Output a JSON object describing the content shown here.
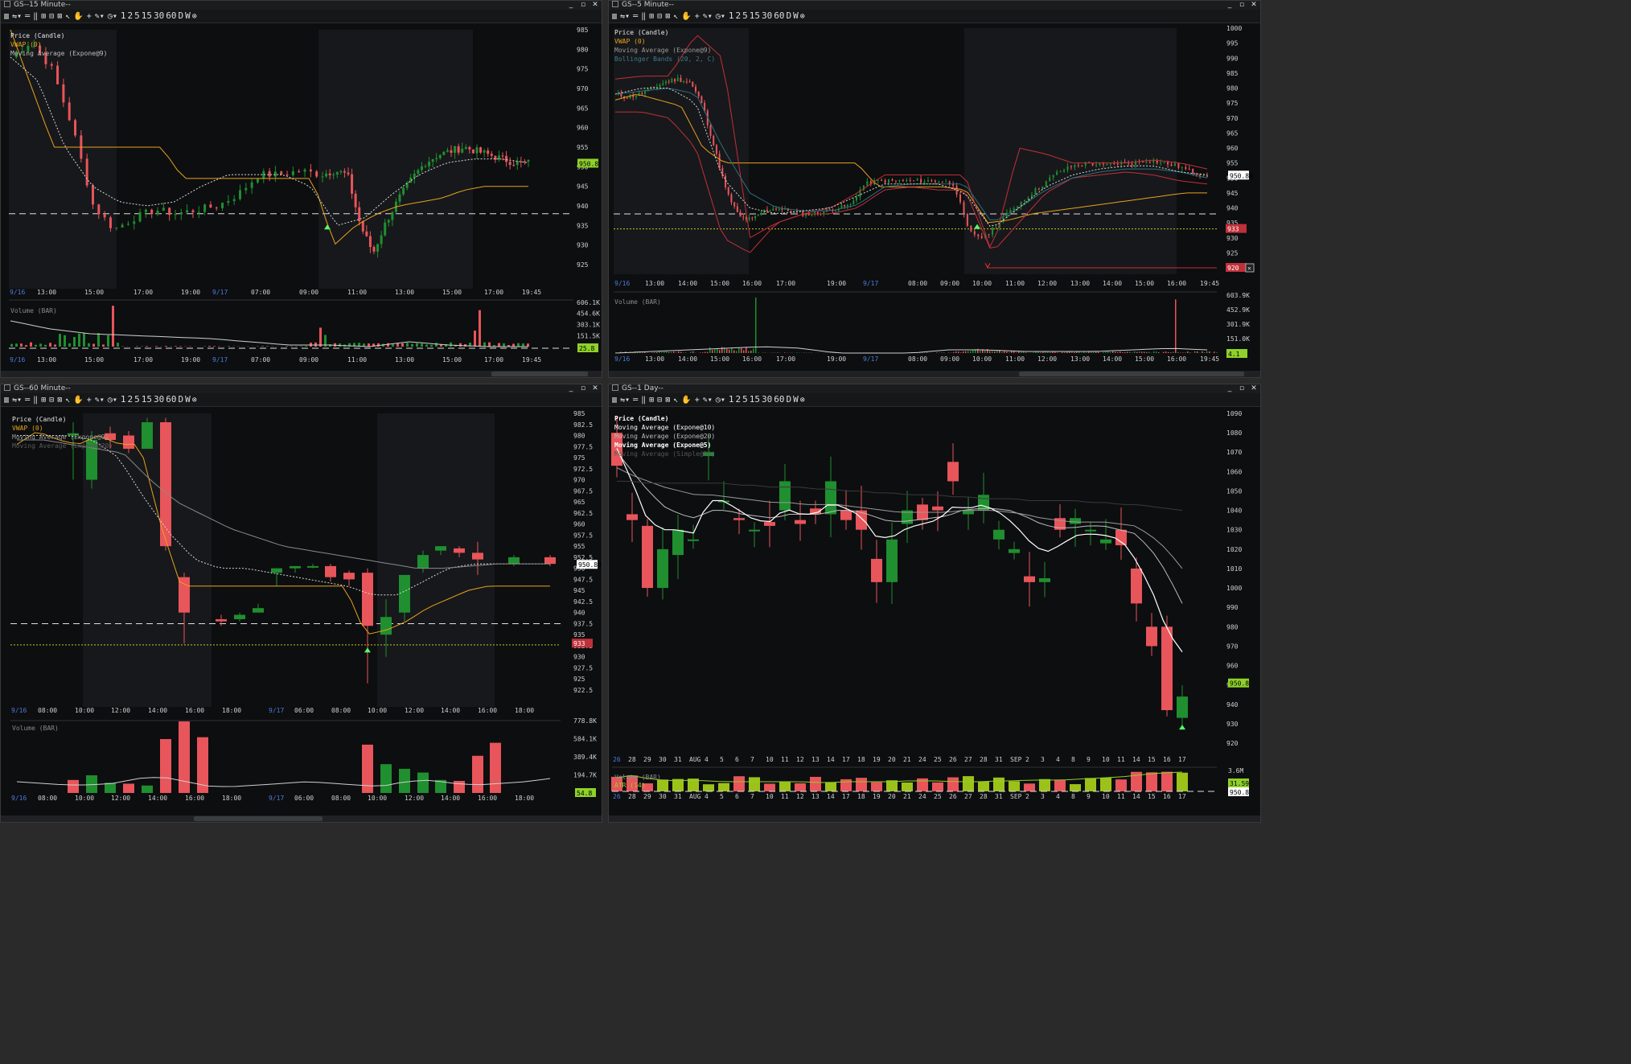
{
  "toolbar": {
    "timeframes": [
      "1",
      "2",
      "5",
      "15",
      "30",
      "60",
      "D",
      "W"
    ]
  },
  "panels": {
    "p15": {
      "title": "GS--15 Minute--",
      "legend": [
        "Price (Candle)",
        "VWAP (0)",
        "Moving Average (Expone@9)"
      ],
      "price_ticks": [
        "985",
        "980",
        "975",
        "970",
        "965",
        "960",
        "955",
        "950",
        "945",
        "940",
        "935",
        "930",
        "925"
      ],
      "last_price": "950.8",
      "time_labels": [
        "9/16",
        "13:00",
        "15:00",
        "17:00",
        "19:00",
        "9/17",
        "07:00",
        "09:00",
        "11:00",
        "13:00",
        "15:00",
        "17:00",
        "19:45"
      ],
      "volume_label": "Volume (BAR)",
      "volume_ticks": [
        "606.1K",
        "454.6K",
        "303.1K",
        "151.5K"
      ],
      "volume_last": "25.8"
    },
    "p5": {
      "title": "GS--5 Minute--",
      "legend": [
        "Price (Candle)",
        "VWAP (0)",
        "Moving Average (Expone@9)",
        "Bollinger Bands (20, 2, C)"
      ],
      "price_ticks": [
        "1000",
        "995",
        "990",
        "985",
        "980",
        "975",
        "970",
        "965",
        "960",
        "955",
        "950",
        "945",
        "940",
        "935",
        "930",
        "925",
        "920"
      ],
      "last_price": "950.80",
      "marker_933": "933",
      "marker_920": "920",
      "time_labels": [
        "9/16",
        "13:00",
        "14:00",
        "15:00",
        "16:00",
        "17:00",
        "19:00",
        "9/17",
        "08:00",
        "09:00",
        "10:00",
        "11:00",
        "12:00",
        "13:00",
        "14:00",
        "15:00",
        "16:00",
        "19:45"
      ],
      "volume_label": "Volume (BAR)",
      "volume_ticks": [
        "603.9K",
        "452.9K",
        "301.9K",
        "151.0K"
      ],
      "volume_last": "4.1"
    },
    "p60": {
      "title": "GS--60 Minute--",
      "legend": [
        "Price (Candle)",
        "VWAP (0)",
        "Moving Average (Expone@9)",
        "Moving Average (Expone@20)"
      ],
      "price_ticks": [
        "985",
        "982.5",
        "980",
        "977.5",
        "975",
        "972.5",
        "970",
        "967.5",
        "965",
        "962.5",
        "960",
        "957.5",
        "955",
        "952.5",
        "950",
        "947.5",
        "945",
        "942.5",
        "940",
        "937.5",
        "935",
        "932.5",
        "930",
        "927.5",
        "925",
        "922.5"
      ],
      "last_price": "950.80",
      "marker_933": "933",
      "time_labels": [
        "9/16",
        "08:00",
        "10:00",
        "12:00",
        "14:00",
        "16:00",
        "18:00",
        "9/17",
        "06:00",
        "08:00",
        "10:00",
        "12:00",
        "14:00",
        "16:00",
        "18:00"
      ],
      "volume_label": "Volume (BAR)",
      "volume_ticks": [
        "778.8K",
        "584.1K",
        "389.4K",
        "194.7K"
      ],
      "volume_last": "54.8"
    },
    "p1d": {
      "title": "GS--1 Day--",
      "legend": [
        "Price (Candle)",
        "Moving Average (Expone@10)",
        "Moving Average (Expone@20)",
        "Moving Average (Expone@5)",
        "Moving Average (Simple@50)"
      ],
      "price_ticks": [
        "1090",
        "1080",
        "1070",
        "1060",
        "1050",
        "1040",
        "1030",
        "1020",
        "1010",
        "1000",
        "990",
        "980",
        "970",
        "960",
        "950",
        "940",
        "930",
        "920"
      ],
      "last_price": "950.8",
      "time_labels": [
        "26",
        "28",
        "29",
        "30",
        "31",
        "AUG",
        "4",
        "5",
        "6",
        "7",
        "10",
        "11",
        "12",
        "13",
        "14",
        "17",
        "18",
        "19",
        "20",
        "21",
        "24",
        "25",
        "26",
        "27",
        "28",
        "31",
        "SEP",
        "2",
        "3",
        "4",
        "8",
        "9",
        "10",
        "11",
        "14",
        "15",
        "16",
        "17"
      ],
      "volume_label": "Volume (BAR)",
      "atr_label": "ATR (14)",
      "volume_ticks": [
        "3.6M"
      ],
      "volume_last": "31.59",
      "volume_last2": "950.8"
    }
  },
  "colors": {
    "up": "#1f8f2f",
    "down": "#e8555a",
    "vwap": "#e8a21c",
    "bb": "#c0303a",
    "ma": "#cfcfcf",
    "tag_green": "#8fd12a",
    "atr": "#8fd12a"
  }
}
